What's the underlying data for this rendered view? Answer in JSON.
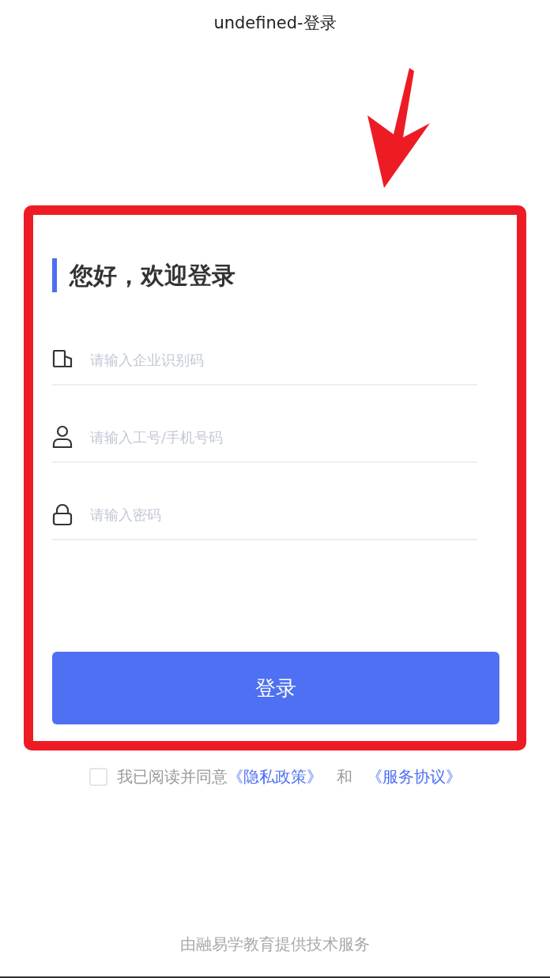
{
  "window": {
    "title": "undefined-登录"
  },
  "form": {
    "heading": "您好，欢迎登录",
    "fields": [
      {
        "kind": "company",
        "placeholder": "请输入企业识别码"
      },
      {
        "kind": "user",
        "placeholder": "请输入工号/手机号码"
      },
      {
        "kind": "password",
        "placeholder": "请输入密码"
      }
    ],
    "submit": "登录"
  },
  "agreement": {
    "checked": false,
    "parts": [
      {
        "kind": "text",
        "text": "我已阅读并同意"
      },
      {
        "kind": "link",
        "text": "《隐私政策》"
      },
      {
        "kind": "text",
        "text": "和"
      },
      {
        "kind": "link",
        "text": "《服务协议》"
      }
    ]
  },
  "footer": "由融易学教育提供技术服务"
}
